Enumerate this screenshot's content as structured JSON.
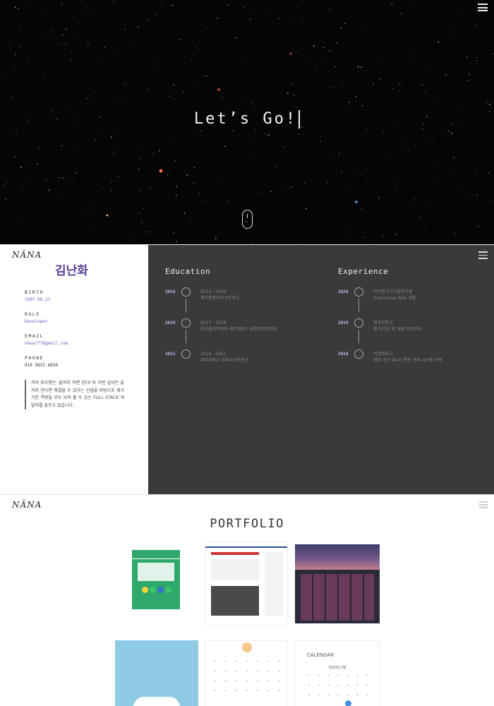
{
  "hero": {
    "title": "Let’s Go!"
  },
  "profile": {
    "logo": "NÄNA",
    "name": "김난화",
    "info": [
      {
        "label": "BIRTH",
        "value": "1997 08.23"
      },
      {
        "label": "ROLE",
        "value": "Developer"
      },
      {
        "label": "EMAIL",
        "value": "nhwa777@gmail.com"
      },
      {
        "label": "PHONE",
        "value": "010 5815 6830"
      }
    ],
    "intro": "저의 좌우명은 '끝까지 하면 된다!'로 어떤 일이든 끝까지 한다면 해결할 수 있다는 신념을 바탕으로 제가 가진 역량을 모두 보여 줄 수 있는 FULL STACK 개발자를 꿈꾸고 있습니다.",
    "education": {
      "title": "Education",
      "items": [
        {
          "year": "2016",
          "period": "2013 - 2016",
          "text": "제주중앙여자고등학교"
        },
        {
          "year": "2019",
          "period": "2017 - 2019",
          "text": "한국폴리텍대학 제주캠퍼스 융합디자인전공"
        },
        {
          "year": "2021",
          "period": "2019 - 2021",
          "text": "제주대학교 컴퓨터공학전공"
        }
      ]
    },
    "experience": {
      "title": "Experience",
      "items": [
        {
          "year": "2020",
          "period": "아쿠랩 ICT기술연구원",
          "text": "Interactive Web 개발"
        },
        {
          "year": "2019",
          "period": "제주방주고",
          "text": "웹 디자인 및 개발 외부강사"
        },
        {
          "year": "2018",
          "period": "이엔컴퍼니",
          "text": "제주 공공 Wi-Fi 통합 관제 시스템 구축"
        }
      ]
    }
  },
  "portfolio": {
    "logo": "NÄNA",
    "title": "PORTFOLIO",
    "calendar_label": "CALENDAR",
    "calendar_month": "2020년 2월"
  }
}
